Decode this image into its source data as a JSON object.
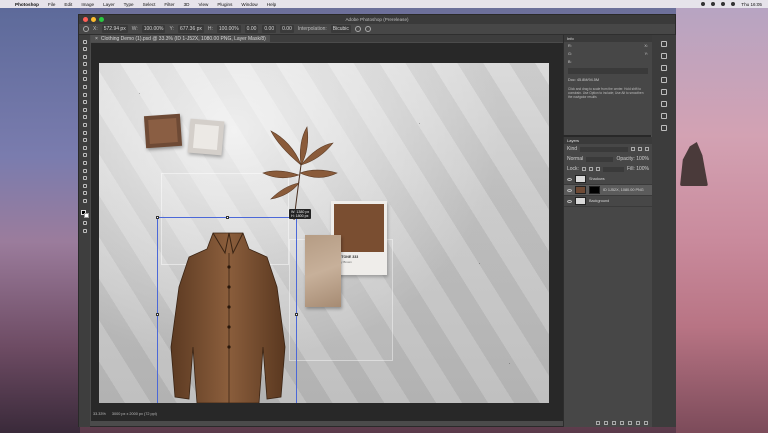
{
  "menubar": {
    "app_name": "Photoshop",
    "items": [
      "File",
      "Edit",
      "Image",
      "Layer",
      "Type",
      "Select",
      "Filter",
      "3D",
      "View",
      "Plugins",
      "Window",
      "Help"
    ],
    "clock": "Thu 16:05"
  },
  "window": {
    "title": "Adobe Photoshop (Prerelease)"
  },
  "options": {
    "x_value": "572.94 px",
    "w_value": "100.00%",
    "y_value": "677.36 px",
    "h_value": "100.00%",
    "angle_value": "0.00",
    "h_skew": "0.00",
    "v_skew": "0.00",
    "interpolation_label": "Interpolation:",
    "interpolation_value": "Bicubic"
  },
  "tab": {
    "title": "Clothing Demo (1).psd @ 33.3% (ID 1-J52X, 1080.00 PNG, Layer Mask/8)",
    "close": "×"
  },
  "hud": {
    "w": "W: 1380 px",
    "h": "H: 1800 px"
  },
  "pantone": {
    "name": "PANTONE 333",
    "sub": "Tawny Brown"
  },
  "status": {
    "zoom": "33.33%",
    "doc": "3000 px x 2000 px (72 ppi)"
  },
  "properties": {
    "title": "Info",
    "r_label": "R:",
    "g_label": "G:",
    "b_label": "B:",
    "x_label": "X:",
    "y_label": "Y:",
    "doc_label": "Doc: 45.8M/94.5M",
    "note": "Click and drag to scale from the center. Hold shift to constrain. Use Option to include; Use Alt to smoothen the navigator results"
  },
  "layers": {
    "title": "Layers",
    "kind_label": "Kind",
    "blend_mode": "Normal",
    "opacity_label": "Opacity: 100%",
    "lock_label": "Lock:",
    "fill_label": "Fill: 100%",
    "items": [
      {
        "name": "Shadows"
      },
      {
        "name": "ID 1J52X, 1080.00 PNG"
      },
      {
        "name": "Background"
      }
    ]
  }
}
